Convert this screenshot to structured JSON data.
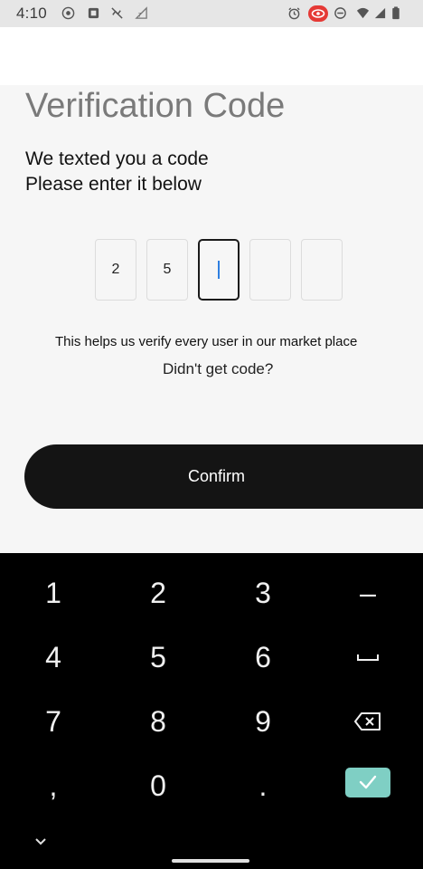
{
  "status_bar": {
    "time": "4:10",
    "left_icons": [
      "record-icon",
      "media-icon",
      "no-sync-icon",
      "signal-off-icon"
    ],
    "right_icons": [
      "alarm-icon",
      "eye-icon",
      "dnd-icon",
      "wifi-icon",
      "cell-signal-icon",
      "battery-icon"
    ],
    "eye_badge_color": "#e53935"
  },
  "screen": {
    "title": "Verification Code",
    "subtitle_line1": "We texted you a code",
    "subtitle_line2": "Please enter it below",
    "otp_digits": [
      "2",
      "5",
      "",
      "",
      ""
    ],
    "active_index": 2,
    "helper_text": "This helps us verify every user in our market place",
    "resend_text": "Didn't get code?",
    "confirm_label": "Confirm"
  },
  "keyboard": {
    "rows": [
      [
        "1",
        "2",
        "3",
        "–"
      ],
      [
        "4",
        "5",
        "6",
        "space"
      ],
      [
        "7",
        "8",
        "9",
        "backspace"
      ],
      [
        ",",
        "0",
        ".",
        "enter"
      ]
    ],
    "accent_color": "#7fcfc4"
  }
}
